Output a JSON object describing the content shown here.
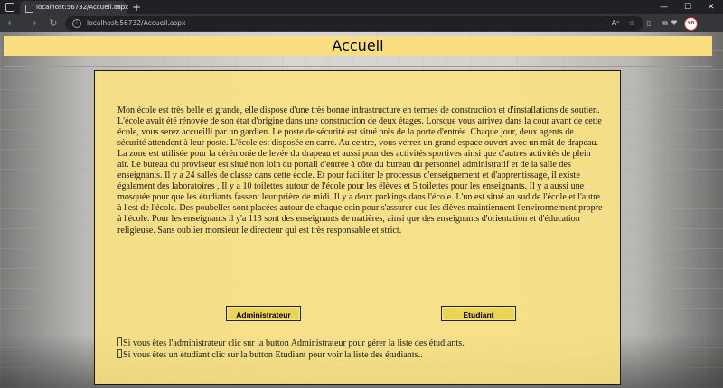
{
  "browser": {
    "tab_title": "localhost:56732/Accueil.aspx",
    "url": "localhost:56732/Accueil.aspx",
    "profile_initials": "YR"
  },
  "page": {
    "heading": "Accueil",
    "paragraph": "Mon école est très belle et grande, elle dispose d'une très bonne infrastructure en termes de construction et d'installations de soutien. L'école avait été rénovée de son état d'origine dans une construction de deux étages. Lorsque vous arrivez dans la cour avant de cette école, vous serez accueilli par un gardien. Le poste de sécurité est situé près de la porte d'entrée. Chaque jour, deux agents de sécurité attendent à leur poste. L'école est disposée en carré. Au centre, vous verrez un grand espace ouvert avec un mât de drapeau. La zone est utilisée pour la cérémonie de levée du drapeau et aussi pour des activités sportives ainsi que d'autres activités de plein air. Le bureau du proviseur est situé non loin du portail d'entrée à côté du bureau du personnel administratif et de la salle des enseignants. Il y a 24 salles de classe dans cette école. Et pour faciliter le processus d'enseignement et d'apprentissage, il existe également des laboratoires , Il y a 10 toilettes autour de l'école pour les élèves et 5 toilettes pour les enseignants. Il y a aussi une mosquée pour que les étudiants fassent leur prière de midi. Il y a deux parkings dans l'école. L'un est situé au sud de l'école et l'autre à l'est de l'école. Des poubelles sont placées autour de chaque coin pour s'assurer que les élèves maintiennent l'environnement propre à l'école. Pour les enseignants il y'a 113 sont des enseignants de matières, ainsi que des enseignants d'orientation et d'éducation religieuse. Sans oublier monsieur le directeur qui est très responsable et strict.",
    "admin_button": "Administrateur",
    "student_button": "Etudiant",
    "hint_admin": "Si vous êtes l'administrateur clic sur la button Administrateur pour gérer la liste des étudiants.",
    "hint_student": "Si vous êtes un étudiant clic sur la button Etudiant pour voir la liste des étudiants.."
  },
  "colors": {
    "header_bg": "#f9de82",
    "panel_bg": "#fae182",
    "button_bg": "#ecd454"
  }
}
